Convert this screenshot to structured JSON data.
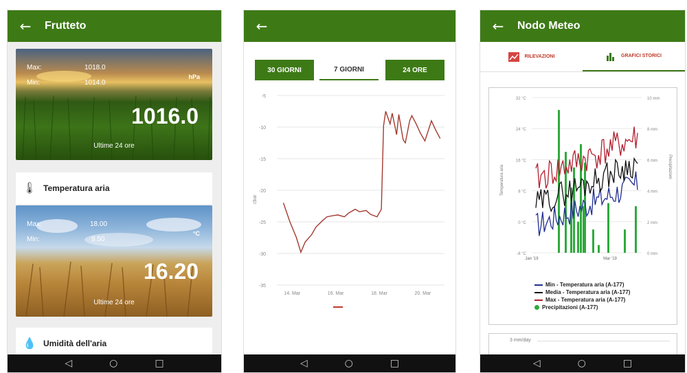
{
  "screen1": {
    "title": "Frutteto",
    "pressure": {
      "max_label": "Max:",
      "max": "1018.0",
      "min_label": "Min:",
      "min": "1014.0",
      "unit": "hPa",
      "value": "1016.0",
      "period": "Ultime 24 ore"
    },
    "temp_row": "Temperatura aria",
    "temp": {
      "max_label": "Max:",
      "max": "18.00",
      "min_label": "Min:",
      "min": "9.50",
      "unit": "°C",
      "value": "16.20",
      "period": "Ultime 24 ore"
    },
    "hum_row": "Umidità dell'aria"
  },
  "screen2": {
    "buttons": [
      "30 GIORNI",
      "7 GIORNI",
      "24 ORE"
    ],
    "chart_data": {
      "type": "line",
      "ylabel": "cbar",
      "ylim": [
        -35,
        -5
      ],
      "yticks": [
        "-5",
        "-10",
        "-15",
        "-20",
        "-25",
        "-30",
        "-35"
      ],
      "xticks": [
        "14. Mar",
        "16. Mar",
        "18. Mar",
        "20. Mar"
      ],
      "series": [
        {
          "color": "#a33a2f",
          "x": [
            13.6,
            13.9,
            14.2,
            14.4,
            14.6,
            14.9,
            15.1,
            15.4,
            15.6,
            15.9,
            16.1,
            16.4,
            16.6,
            16.9,
            17.1,
            17.4,
            17.6,
            17.9,
            18.1,
            18.2,
            18.3,
            18.5,
            18.6,
            18.8,
            18.9,
            19.1,
            19.2,
            19.4,
            19.5,
            19.7,
            19.9,
            20.1,
            20.4,
            20.6,
            20.8
          ],
          "y": [
            -22.0,
            -25,
            -27.5,
            -29.8,
            -28.2,
            -27.0,
            -25.8,
            -24.8,
            -24.2,
            -24.0,
            -23.9,
            -24.2,
            -23.6,
            -23.0,
            -23.4,
            -23.2,
            -23.8,
            -24.2,
            -23.0,
            -9.8,
            -7.5,
            -9.5,
            -7.8,
            -11.2,
            -8.0,
            -12.0,
            -12.5,
            -9.0,
            -8.2,
            -9.5,
            -11.0,
            -12.2,
            -9.0,
            -10.5,
            -11.8
          ]
        }
      ]
    },
    "legend_marker_color": "#c0392b"
  },
  "screen3": {
    "title": "Nodo Meteo",
    "tabs": [
      "RILEVAZIONI",
      "GRAFICI STORICI"
    ],
    "chart_data": {
      "type": "line",
      "ylabel": "Temperatura aria",
      "y2label": "Precipitazioni",
      "ylim": [
        -8,
        32
      ],
      "yticks": [
        "32 °C",
        "24 °C",
        "16 °C",
        "8 °C",
        "0 °C",
        "-8 °C"
      ],
      "y2ticks": [
        "10 mm",
        "8 mm",
        "6 mm",
        "4 mm",
        "2 mm",
        "0 mm"
      ],
      "xticks": [
        "Jan '19",
        "Mar '19"
      ],
      "series": [
        {
          "name": "Min - Temperatura aria (A-177)",
          "color": "#1f2d8f"
        },
        {
          "name": "Media - Temperatura aria (A-177)",
          "color": "#111111"
        },
        {
          "name": "Max - Temperatura aria (A-177)",
          "color": "#b01e2e"
        },
        {
          "name": "Precipitazioni (A-177)",
          "color": "#2eaa3c"
        }
      ]
    },
    "second_chart_tick": "3 mm/day"
  },
  "nav": {
    "back": "◁",
    "home": "○",
    "recents": "□"
  }
}
